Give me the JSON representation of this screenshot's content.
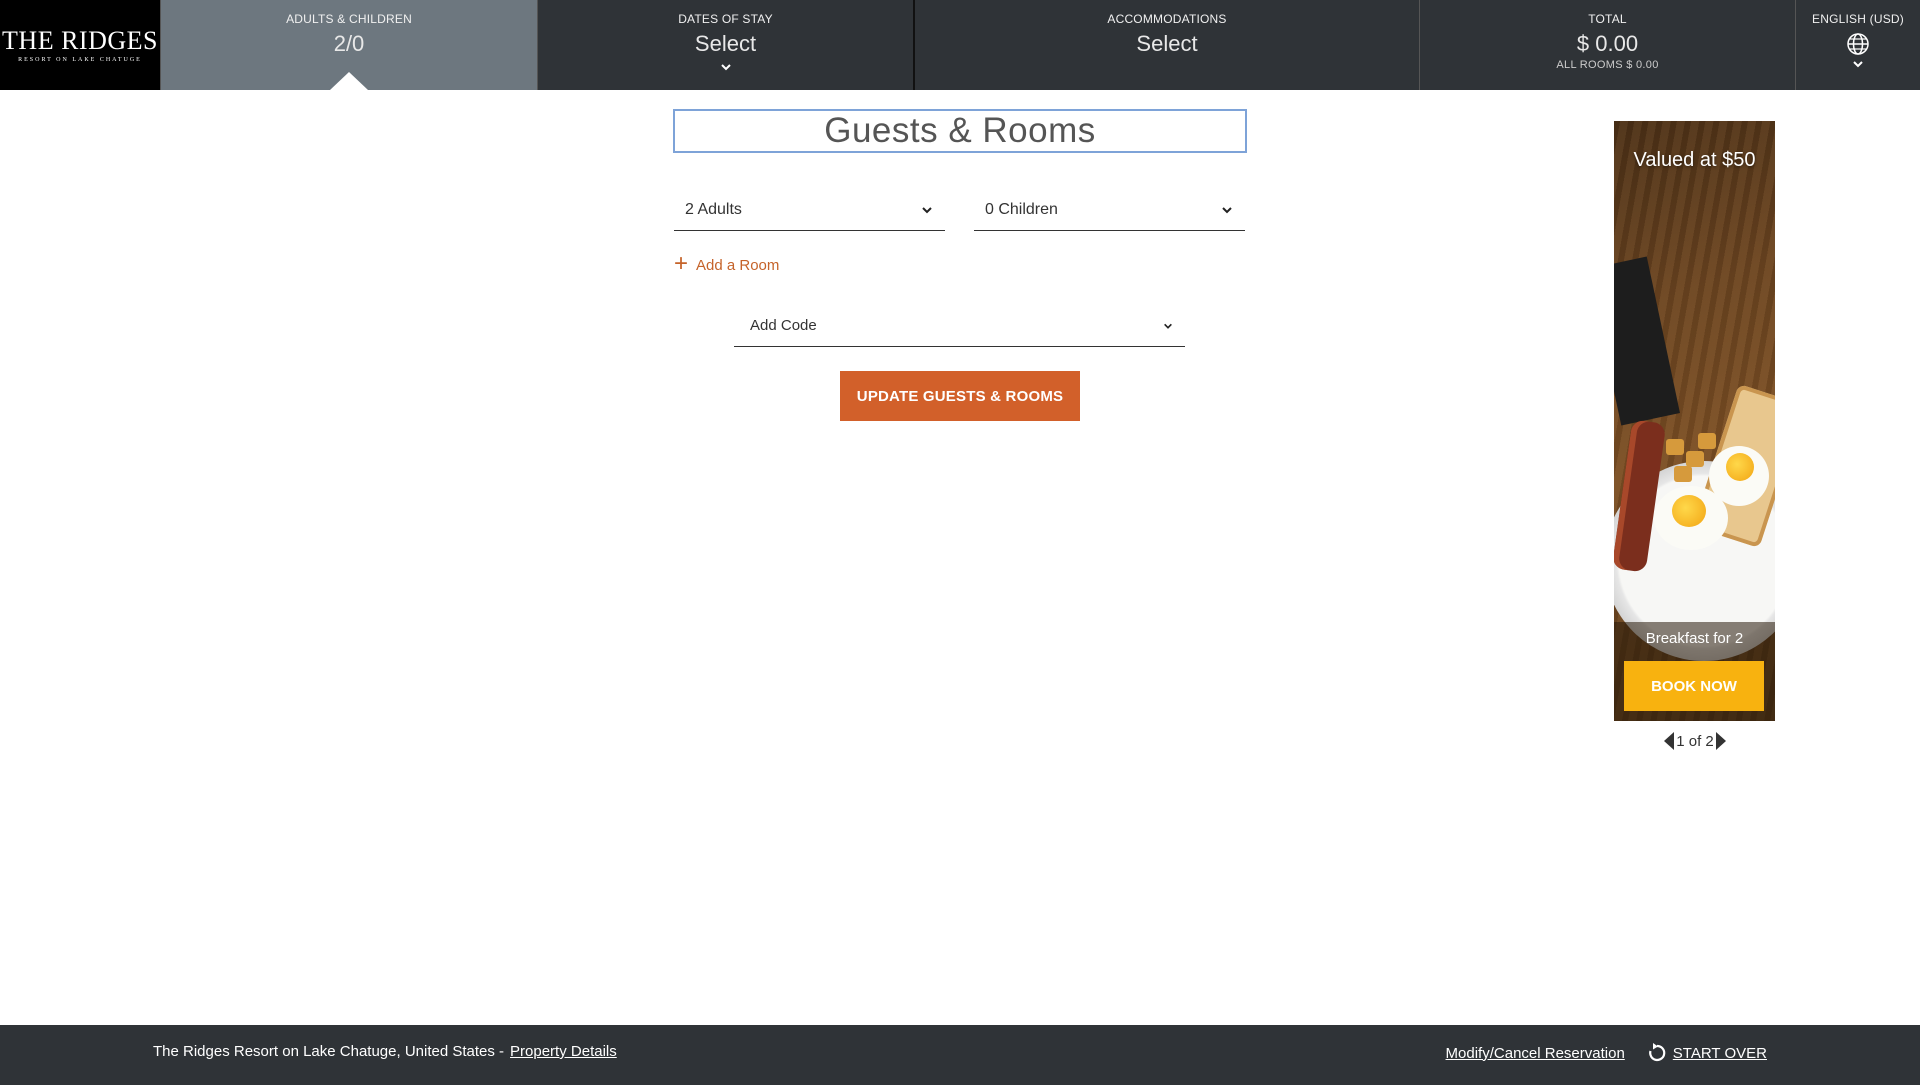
{
  "logo": {
    "main": "THE RIDGES",
    "sub": "RESORT ON LAKE CHATUGE"
  },
  "nav": {
    "guests": {
      "label": "ADULTS & CHILDREN",
      "value": "2/0"
    },
    "dates": {
      "label": "DATES OF STAY",
      "value": "Select",
      "icon": "chevron-down-icon"
    },
    "accommodations": {
      "label": "ACCOMMODATIONS",
      "value": "Select"
    },
    "total": {
      "label": "TOTAL",
      "value": "$ 0.00",
      "sub": "ALL ROOMS $ 0.00"
    },
    "language": {
      "label": "ENGLISH (USD)",
      "icon": "globe-icon"
    }
  },
  "panel": {
    "title": "Guests & Rooms",
    "adults_select": "2 Adults",
    "children_select": "0 Children",
    "add_room": "Add a Room",
    "code_select": "Add Code",
    "update_button": "UPDATE GUESTS & ROOMS"
  },
  "promo": {
    "headline": "Valued at $50",
    "caption": "Breakfast for 2",
    "book_button": "BOOK NOW",
    "pager": "1 of 2"
  },
  "footer": {
    "property": "The Ridges Resort on Lake Chatuge, United States -",
    "property_link": "Property Details",
    "modify_link": "Modify/Cancel Reservation",
    "start_over": "START OVER"
  },
  "colors": {
    "nav_bg": "#2f3337",
    "nav_active": "#6d777f",
    "accent_orange": "#d2602a",
    "book_yellow": "#f8b20f",
    "title_border": "#7ea3d8"
  }
}
